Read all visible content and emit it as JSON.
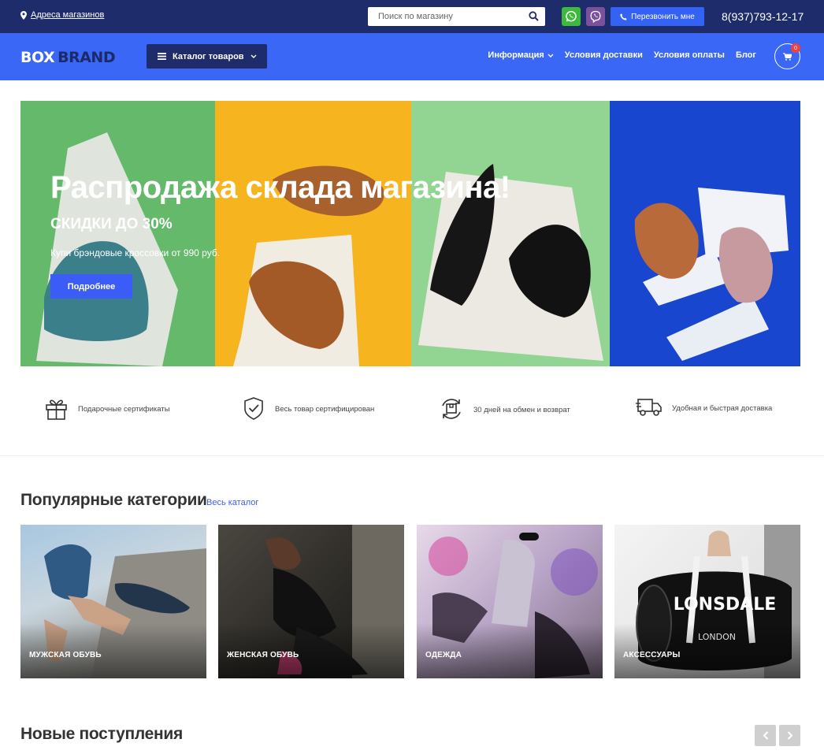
{
  "topbar": {
    "address_label": "Адреса магазинов",
    "search_placeholder": "Поиск по магазину",
    "callback_label": "Перезвонить мне",
    "phone": "8(937)793-12-17"
  },
  "nav": {
    "logo_box": "BOX",
    "logo_brand": "BRAND",
    "catalog_label": "Каталог товаров",
    "links": [
      "Информация",
      "Условия доставки",
      "Условия оплаты",
      "Блог"
    ],
    "cart_count": "0"
  },
  "hero": {
    "title": "Распродажа склада магазина!",
    "subtitle": "СКИДКИ ДО 30%",
    "text": "Купи брэндовые кроссовки от 990 руб.",
    "button_label": "Подробнее",
    "panel_colors": [
      "#62b86a",
      "#f5b321",
      "#8fd38f",
      "#1745cc"
    ]
  },
  "features": [
    {
      "icon": "gift-icon",
      "label": "Подарочные сертификаты"
    },
    {
      "icon": "shield-check-icon",
      "label": "Весь товар сертифицирован"
    },
    {
      "icon": "return-box-icon",
      "label": "30 дней на обмен и возврат"
    },
    {
      "icon": "truck-icon",
      "label": "Удобная и быстрая доставка"
    }
  ],
  "categories": {
    "title": "Популярные категории",
    "all_link": "Весь каталог",
    "items": [
      {
        "label": "МУЖСКАЯ ОБУВЬ"
      },
      {
        "label": "ЖЕНСКАЯ ОБУВЬ"
      },
      {
        "label": "ОДЕЖДА"
      },
      {
        "label": "АКСЕССУАРЫ"
      }
    ]
  },
  "new_arrivals": {
    "title": "Новые поступления"
  },
  "colors": {
    "topbar": "#1e2c6b",
    "nav": "#3b67f6",
    "accent": "#3b5cf6"
  }
}
